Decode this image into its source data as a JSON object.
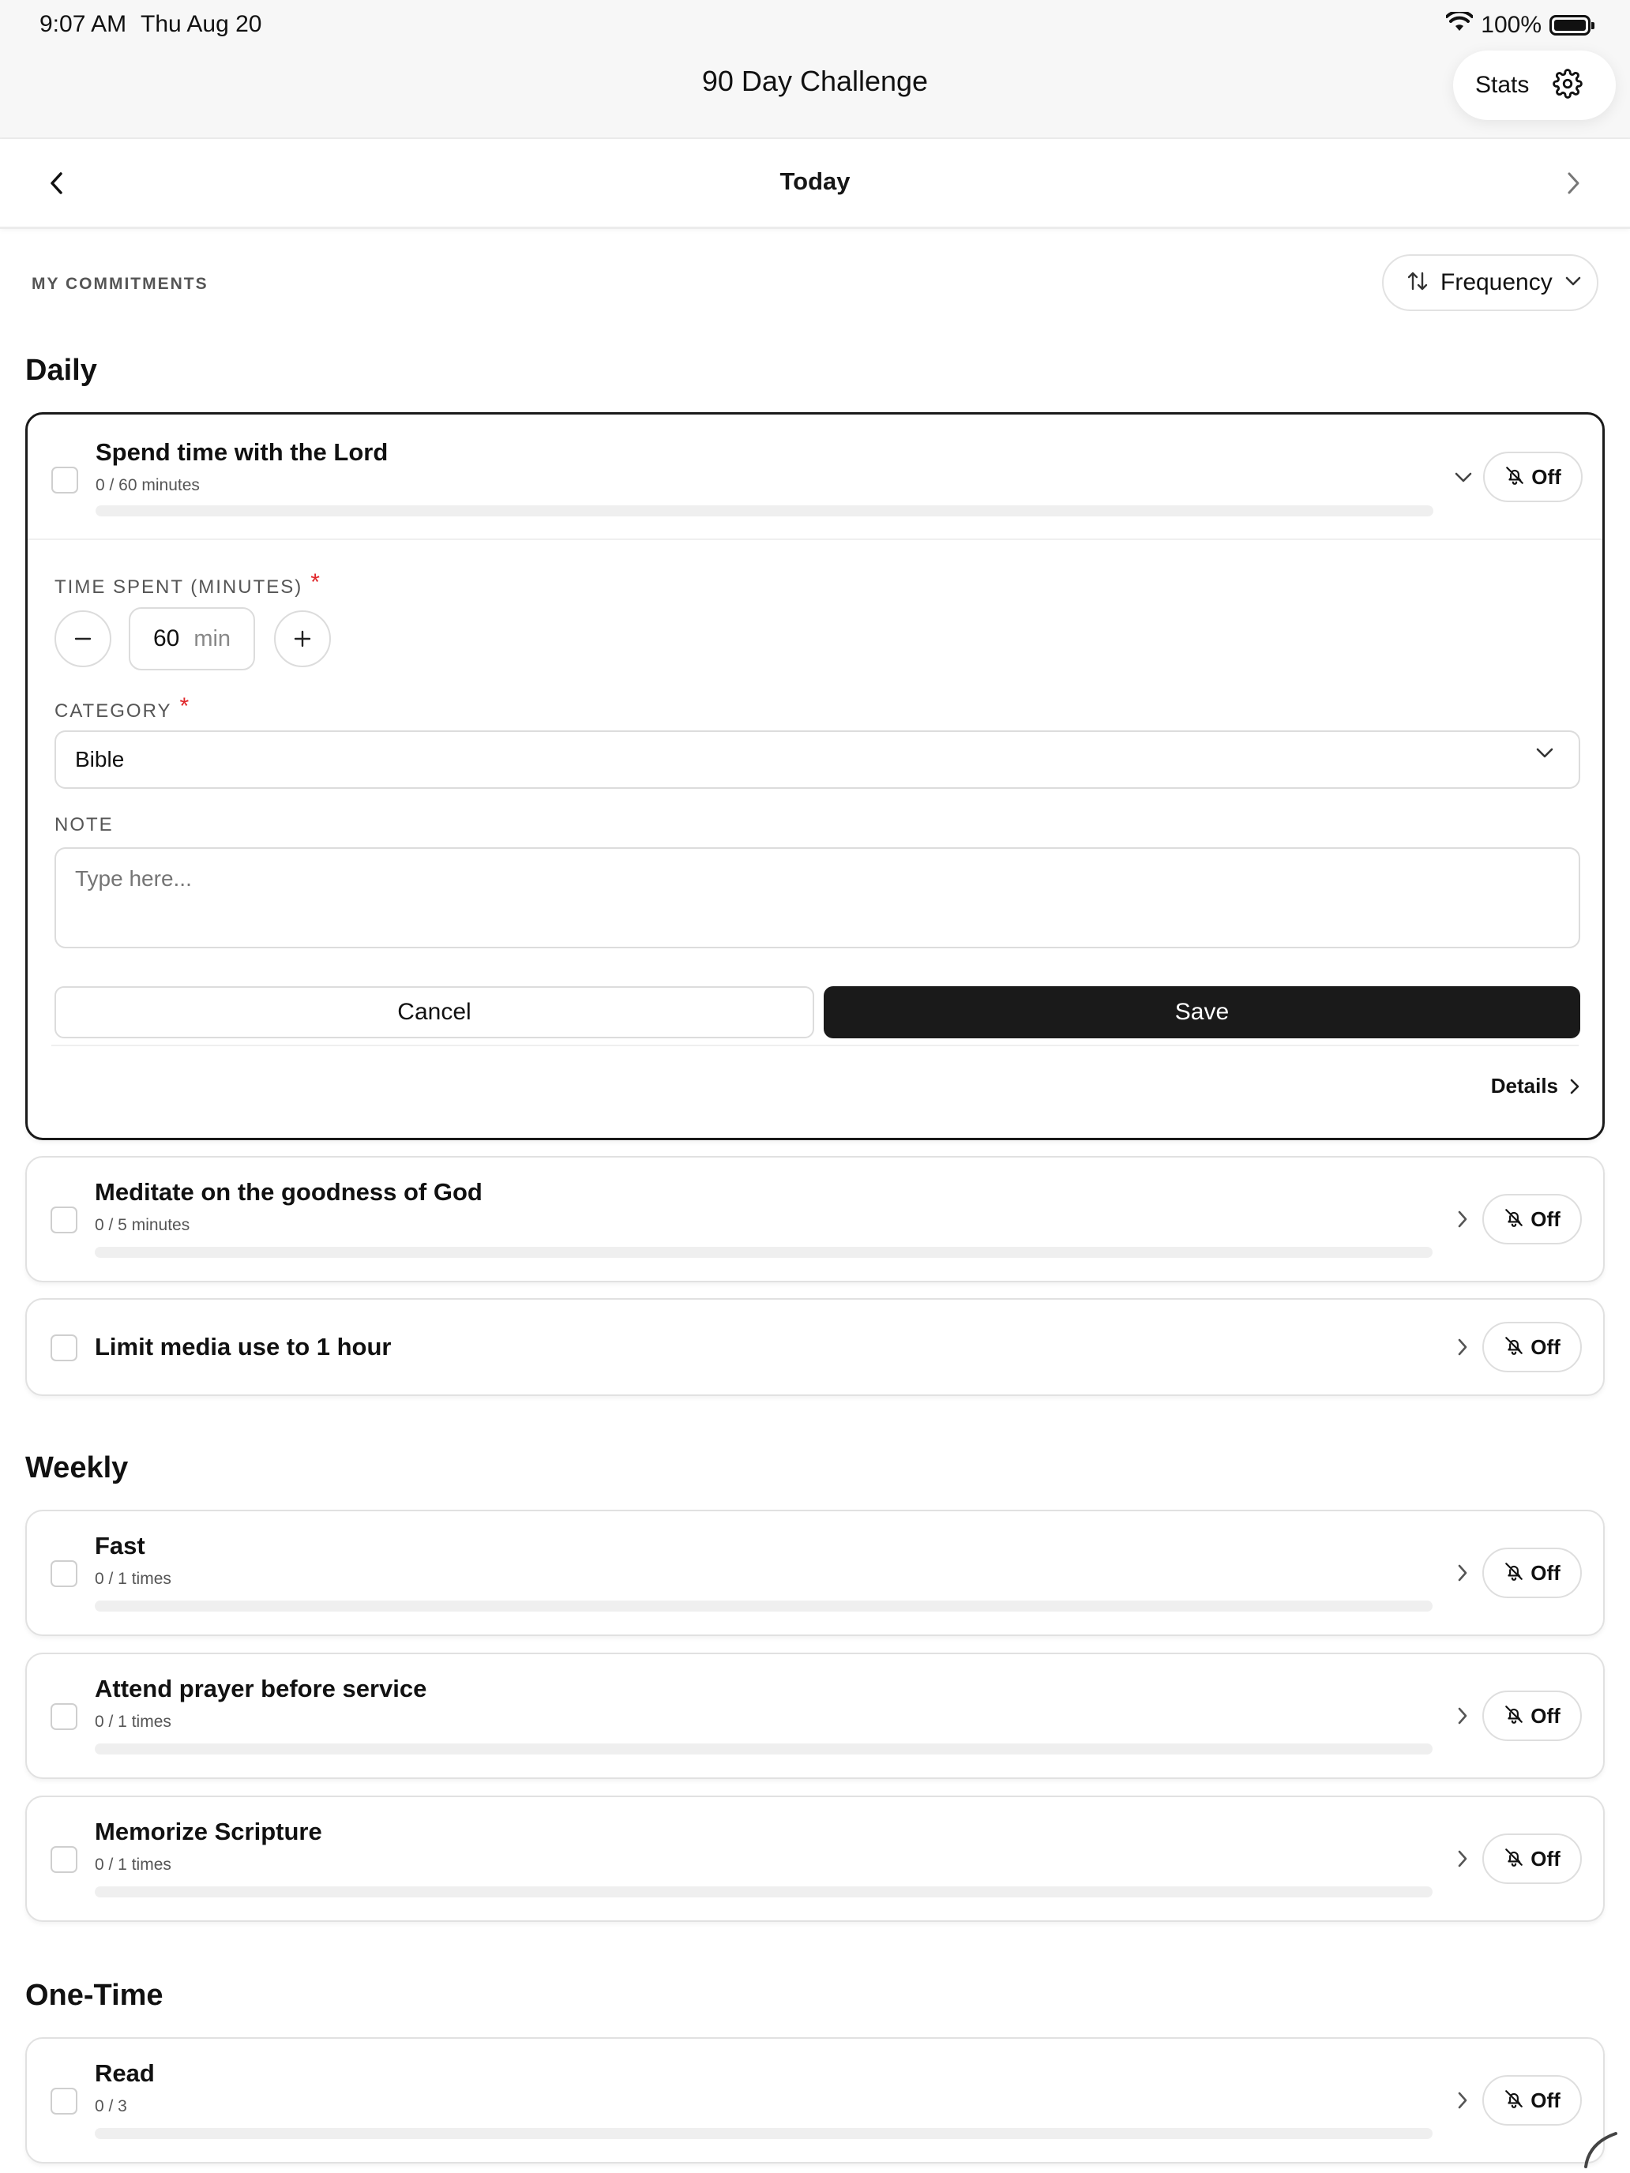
{
  "status_bar": {
    "time": "9:07 AM",
    "date": "Thu Aug 20",
    "battery": "100%"
  },
  "header": {
    "title": "90 Day Challenge",
    "stats_label": "Stats"
  },
  "date_nav": {
    "title": "Today"
  },
  "commitments": {
    "label": "MY COMMITMENTS",
    "sort_label": "Frequency"
  },
  "sections": {
    "daily": "Daily",
    "weekly": "Weekly",
    "one_time": "One-Time"
  },
  "items": [
    {
      "title": "Spend time with the Lord",
      "progress_text": "0 / 60 minutes",
      "progress": 0,
      "reminder": "Off",
      "expanded": true
    },
    {
      "title": "Meditate on the goodness of God",
      "progress_text": "0 / 5 minutes",
      "progress": 0,
      "reminder": "Off"
    },
    {
      "title": "Limit media use to 1 hour",
      "reminder": "Off"
    },
    {
      "title": "Fast",
      "progress_text": "0 / 1 times",
      "progress": 0,
      "reminder": "Off"
    },
    {
      "title": "Attend prayer before service",
      "progress_text": "0 / 1 times",
      "progress": 0,
      "reminder": "Off"
    },
    {
      "title": "Memorize Scripture",
      "progress_text": "0 / 1 times",
      "progress": 0,
      "reminder": "Off"
    },
    {
      "title": "Read",
      "progress_text": "0 / 3",
      "progress": 0,
      "reminder": "Off"
    }
  ],
  "form": {
    "time_label": "TIME SPENT (MINUTES)",
    "required_mark": "*",
    "minutes_value": "60",
    "minutes_unit": "min",
    "category_label": "CATEGORY",
    "category_value": "Bible",
    "note_label": "NOTE",
    "note_placeholder": "Type here...",
    "cancel_label": "Cancel",
    "save_label": "Save",
    "details_label": "Details"
  },
  "colors": {
    "accent": "#1a1a1a",
    "required": "#e0262a",
    "border": "#dcdcdc"
  }
}
